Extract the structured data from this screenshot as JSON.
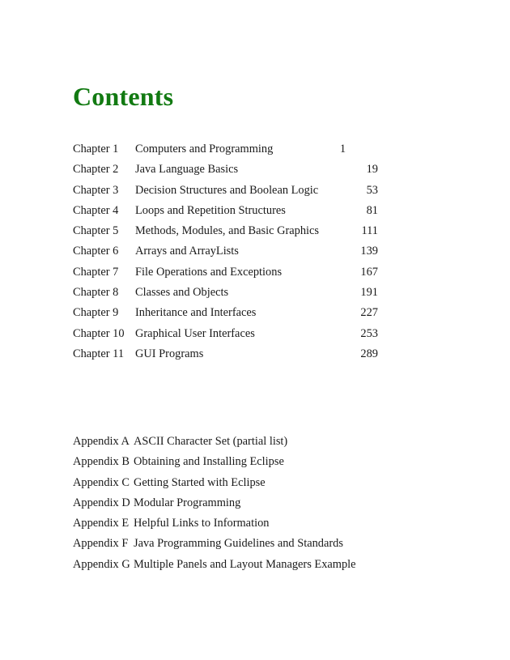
{
  "page": {
    "title": "Contents",
    "title_color": "#127a12",
    "background_color": "#ffffff",
    "text_color": "#1a1a1a"
  },
  "chapters": [
    {
      "label": "Chapter 1",
      "title": "Computers and Programming",
      "page": "1"
    },
    {
      "label": "Chapter 2",
      "title": "Java Language Basics",
      "page": "19"
    },
    {
      "label": "Chapter 3",
      "title": "Decision Structures and Boolean Logic",
      "page": "53"
    },
    {
      "label": "Chapter 4",
      "title": "Loops and Repetition Structures",
      "page": "81"
    },
    {
      "label": "Chapter 5",
      "title": "Methods, Modules, and Basic Graphics",
      "page": "111"
    },
    {
      "label": "Chapter 6",
      "title": "Arrays and ArrayLists",
      "page": "139"
    },
    {
      "label": "Chapter 7",
      "title": "File Operations and Exceptions",
      "page": "167"
    },
    {
      "label": "Chapter 8",
      "title": "Classes and Objects",
      "page": "191"
    },
    {
      "label": "Chapter 9",
      "title": "Inheritance and Interfaces",
      "page": "227"
    },
    {
      "label": "Chapter 10",
      "title": "Graphical User Interfaces",
      "page": "253"
    },
    {
      "label": "Chapter 11",
      "title": "GUI Programs",
      "page": "289"
    }
  ],
  "appendices": [
    {
      "label": "Appendix A",
      "title": "ASCII Character Set (partial list)"
    },
    {
      "label": "Appendix B",
      "title": "Obtaining and Installing Eclipse"
    },
    {
      "label": "Appendix C",
      "title": "Getting Started with Eclipse"
    },
    {
      "label": "Appendix D",
      "title": "Modular Programming"
    },
    {
      "label": "Appendix E",
      "title": "Helpful Links to Information"
    },
    {
      "label": "Appendix F",
      "title": "Java Programming Guidelines and Standards"
    },
    {
      "label": "Appendix G",
      "title": "Multiple Panels and Layout Managers Example"
    }
  ]
}
